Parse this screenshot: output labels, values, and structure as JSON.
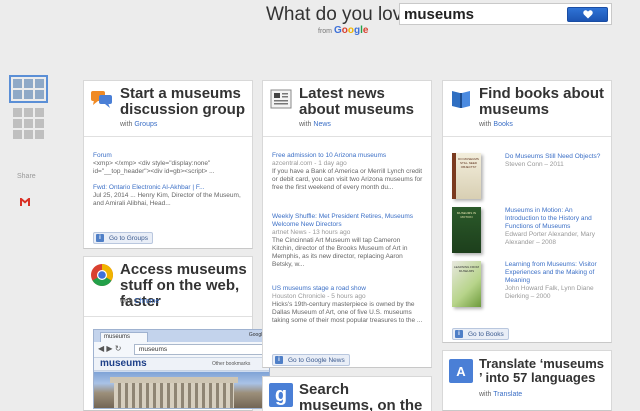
{
  "header": {
    "title": "What do you love?",
    "brand_from": "from",
    "brand_name": [
      "G",
      "o",
      "o",
      "g",
      "l",
      "e"
    ],
    "search_value": "museums"
  },
  "rail": {
    "share_label": "Share"
  },
  "groups": {
    "title": "Start a museums discussion group",
    "with_prefix": "with",
    "with_link": "Groups",
    "items": [
      {
        "title": "Forum",
        "body": "<xmp> </xmp> <div style=\"display:none\" id=\"__top_header\"><div id=gb><script> ..."
      },
      {
        "title": "Fwd: Ontario Electronic Al-Akhbar | F...",
        "body": "Jul 25, 2014 ... Henry Kim, Director of the Museum, and Amirali Alibhai, Head..."
      }
    ],
    "button": "Go to Groups"
  },
  "chrome": {
    "title": "Access museums stuff on the web, faster",
    "with_prefix": "with",
    "with_link": "Chrome",
    "tab_label": "museums",
    "address": "museums",
    "bookmarks": "Other bookmarks",
    "window_label": "Google"
  },
  "news": {
    "title": "Latest news about museums",
    "with_prefix": "with",
    "with_link": "News",
    "items": [
      {
        "title": "Free admission to 10 Arizona museums",
        "meta": "azcentral.com - 1 day ago",
        "body": "If you have a Bank of America or Merrill Lynch credit or debit card, you can visit two Arizona museums for free the first weekend of every month du..."
      },
      {
        "title": "Weekly Shuffle: Met President Retires, Museums Welcome New Directors",
        "meta": "artnet News - 13 hours ago",
        "body": "The Cincinnati Art Museum will tap Cameron Kitchin, director of the Brooks Museum of Art in Memphis, as its new director, replacing Aaron Betsky, w..."
      },
      {
        "title": "US museums stage a road show",
        "meta": "Houston Chronicle - 5 hours ago",
        "body": "Hicks's 19th-century masterpiece is owned by the Dallas Museum of Art, one of five U.S. museums taking some of their most popular treasures to the ..."
      }
    ],
    "button": "Go to Google News"
  },
  "search_move": {
    "title": "Search museums, on the move"
  },
  "books": {
    "title": "Find books about museums",
    "with_prefix": "with",
    "with_link": "Books",
    "items": [
      {
        "title": "Do Museums Still Need Objects?",
        "meta": "Steven Conn – 2011",
        "cover_text": "DO MUSEUMS STILL NEED OBJECTS?"
      },
      {
        "title": "Museums in Motion: An Introduction to the History and Functions of Museums",
        "meta": "Edward Porter Alexander, Mary Alexander – 2008",
        "cover_text": "MUSEUMS IN MOTION"
      },
      {
        "title": "Learning from Museums: Visitor Experiences and the Making of Meaning",
        "meta": "John Howard Falk, Lynn Diane Dierking – 2000",
        "cover_text": "LEARNING FROM MUSEUMS"
      }
    ],
    "button": "Go to Books"
  },
  "translate": {
    "title": "Translate ‘museums ’ into 57 languages",
    "with_prefix": "with",
    "with_link": "Translate"
  },
  "colors": {
    "accent": "#3b6fc6",
    "search_button": "#2f73d6",
    "gmail_red": "#d93025"
  }
}
